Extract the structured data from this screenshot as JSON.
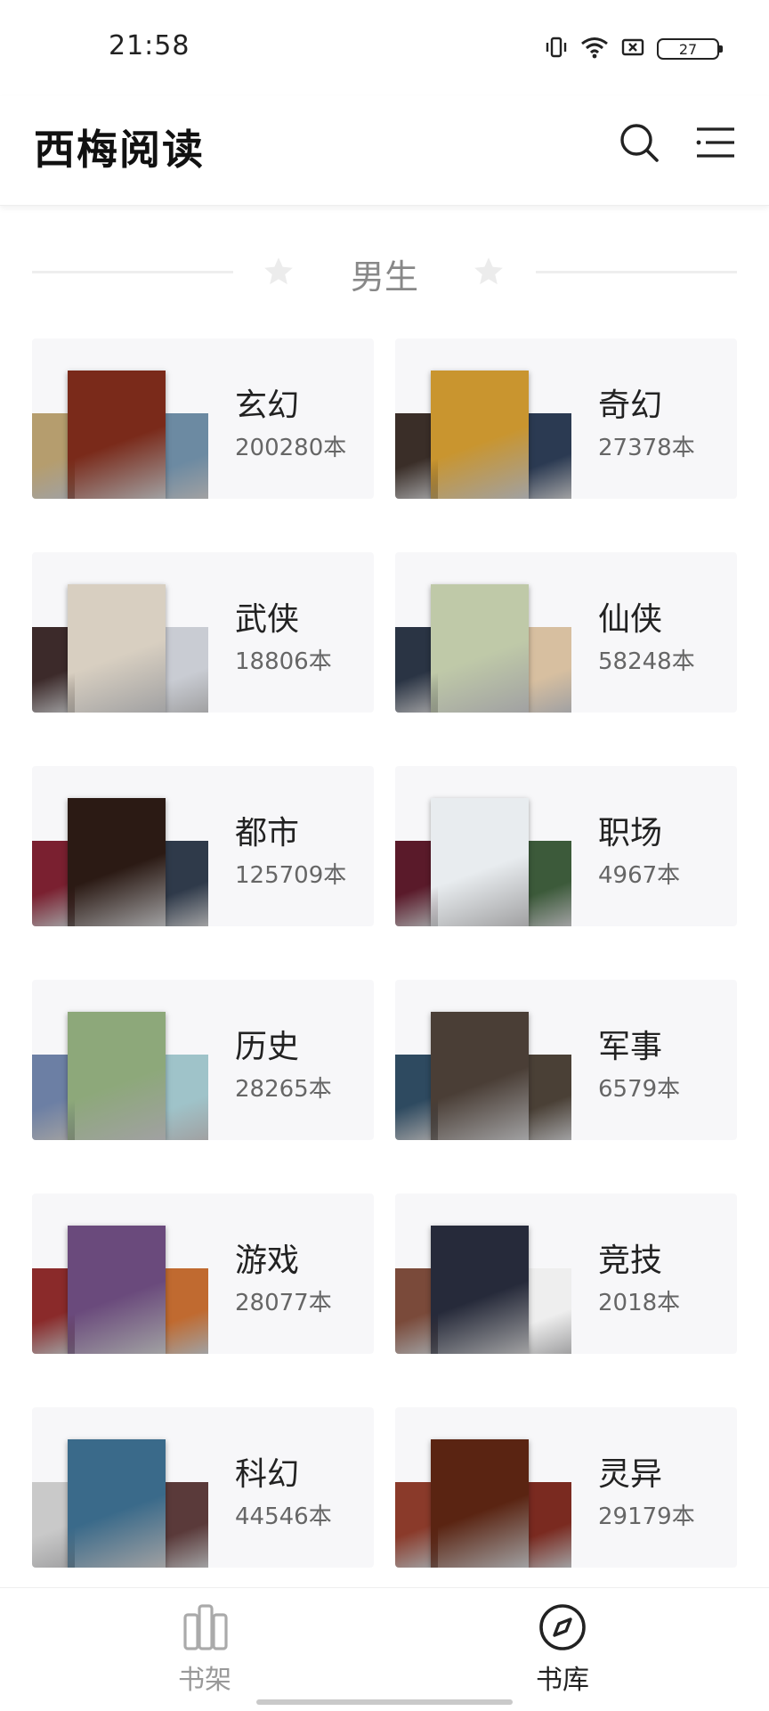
{
  "status_bar": {
    "time": "21:58",
    "battery": "27",
    "icons": [
      "vibrate-icon",
      "wifi-icon",
      "sim-icon",
      "battery-icon"
    ]
  },
  "header": {
    "title": "西梅阅读",
    "icons": [
      "search-icon",
      "menu-icon"
    ]
  },
  "section": {
    "label": "男生"
  },
  "categories": [
    {
      "name": "玄幻",
      "count": "200280本",
      "colors": [
        "#b59d6e",
        "#7a2a1a",
        "#6c8aa2"
      ]
    },
    {
      "name": "奇幻",
      "count": "27378本",
      "colors": [
        "#3a2e28",
        "#c9952f",
        "#2b3a52"
      ]
    },
    {
      "name": "武侠",
      "count": "18806本",
      "colors": [
        "#3c2a2a",
        "#d8cfc1",
        "#c9ccd3"
      ]
    },
    {
      "name": "仙侠",
      "count": "58248本",
      "colors": [
        "#2a3444",
        "#bfc9a8",
        "#d7bfa0"
      ]
    },
    {
      "name": "都市",
      "count": "125709本",
      "colors": [
        "#7a2030",
        "#2b1a14",
        "#2f3a4a"
      ]
    },
    {
      "name": "职场",
      "count": "4967本",
      "colors": [
        "#5a1a2a",
        "#e8ecef",
        "#3c5a3a"
      ]
    },
    {
      "name": "历史",
      "count": "28265本",
      "colors": [
        "#6c7fa4",
        "#8da87a",
        "#9fc3c9"
      ]
    },
    {
      "name": "军事",
      "count": "6579本",
      "colors": [
        "#2e4a60",
        "#4a3e36",
        "#4a4036"
      ]
    },
    {
      "name": "游戏",
      "count": "28077本",
      "colors": [
        "#8a2a2a",
        "#6a4a7c",
        "#c06a30"
      ]
    },
    {
      "name": "竞技",
      "count": "2018本",
      "colors": [
        "#7a4a3a",
        "#262a3a",
        "#eeeeee"
      ]
    },
    {
      "name": "科幻",
      "count": "44546本",
      "colors": [
        "#c9c9c9",
        "#3a6a8a",
        "#5a3a3a"
      ]
    },
    {
      "name": "灵异",
      "count": "29179本",
      "colors": [
        "#8a3a2a",
        "#5a2412",
        "#7a2a20"
      ]
    }
  ],
  "bottom_nav": {
    "items": [
      {
        "label": "书架",
        "icon": "bookshelf-icon",
        "active": false
      },
      {
        "label": "书库",
        "icon": "compass-icon",
        "active": true
      }
    ]
  },
  "colors": {
    "active": "#222222",
    "inactive": "#999999",
    "card_bg": "#f7f7f9"
  }
}
